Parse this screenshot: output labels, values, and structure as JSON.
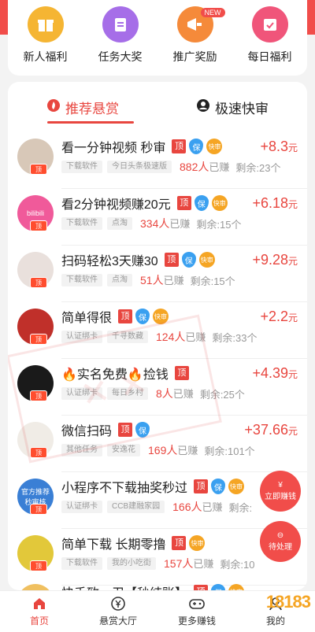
{
  "categories": [
    {
      "label": "新人福利",
      "icon": "gift-icon",
      "color": "#f5b533"
    },
    {
      "label": "任务大奖",
      "icon": "clipboard-icon",
      "color": "#a66ee8"
    },
    {
      "label": "推广奖励",
      "icon": "megaphone-icon",
      "color": "#f58a3a",
      "badge": "NEW"
    },
    {
      "label": "每日福利",
      "icon": "calendar-check-icon",
      "color": "#f0557a"
    }
  ],
  "tabs": [
    {
      "label": "推荐悬赏",
      "active": true,
      "icon": "flame-icon"
    },
    {
      "label": "极速快审",
      "active": false,
      "icon": "person-icon"
    }
  ],
  "tags": {
    "ding": "顶",
    "bao": "保",
    "kuai": "快审"
  },
  "tasks": [
    {
      "title": "看一分钟视频 秒审",
      "reward": "+8.3",
      "unit": "元",
      "chips": [
        "下载软件",
        "今日头条极速版"
      ],
      "earned": "882人",
      "earned_suffix": "已赚",
      "remain": "剩余:23个",
      "ding": true,
      "bao": true,
      "kuai": true,
      "avatar_color": "#d8c8b8"
    },
    {
      "title": "看2分钟视频赚20元",
      "reward": "+6.18",
      "unit": "元",
      "chips": [
        "下载软件",
        "点淘"
      ],
      "earned": "334人",
      "earned_suffix": "已赚",
      "remain": "剩余:15个",
      "ding": true,
      "bao": true,
      "kuai": true,
      "avatar_color": "#f05a9a",
      "avatar_text": "bilibili"
    },
    {
      "title": "扫码轻松3天赚30",
      "reward": "+9.28",
      "unit": "元",
      "chips": [
        "下载软件",
        "点淘"
      ],
      "earned": "51人",
      "earned_suffix": "已赚",
      "remain": "剩余:15个",
      "ding": true,
      "bao": true,
      "kuai": true,
      "avatar_color": "#e9e0dc"
    },
    {
      "title": "简单得很",
      "reward": "+2.2",
      "unit": "元",
      "chips": [
        "认证绑卡",
        "千寻数藏"
      ],
      "earned": "124人",
      "earned_suffix": "已赚",
      "remain": "剩余:33个",
      "ding": true,
      "bao": true,
      "kuai": true,
      "avatar_color": "#c0302a"
    },
    {
      "title": "🔥实名免费🔥捡钱",
      "reward": "+4.39",
      "unit": "元",
      "chips": [
        "认证绑卡",
        "每日乡村"
      ],
      "earned": "8人",
      "earned_suffix": "已赚",
      "remain": "剩余:25个",
      "ding": true,
      "bao": false,
      "kuai": false,
      "avatar_color": "#1a1a1a"
    },
    {
      "title": "微信扫码",
      "reward": "+37.66",
      "unit": "元",
      "chips": [
        "其他任务",
        "安逸花"
      ],
      "earned": "169人",
      "earned_suffix": "已赚",
      "remain": "剩余:101个",
      "ding": true,
      "bao": true,
      "kuai": false,
      "avatar_color": "#f0ece6"
    },
    {
      "title": "小程序不下载抽奖秒过",
      "reward": "",
      "unit": "",
      "chips": [
        "认证绑卡",
        "CCB建融家园"
      ],
      "earned": "166人",
      "earned_suffix": "已赚",
      "remain": "剩余:",
      "ding": true,
      "bao": true,
      "kuai": true,
      "avatar_color": "#3a7fd5",
      "avatar_text": "官方推荐 秒审核"
    },
    {
      "title": "简单下载 长期零撸",
      "reward": "",
      "unit": "",
      "chips": [
        "下载软件",
        "我的小吃街"
      ],
      "earned": "157人",
      "earned_suffix": "已赚",
      "remain": "剩余:10",
      "ding": true,
      "bao": false,
      "kuai": true,
      "avatar_color": "#e2c83a"
    },
    {
      "title": "快手致一卫【秒结账】",
      "reward": "",
      "unit": "",
      "chips": [],
      "earned": "",
      "earned_suffix": "",
      "remain": "",
      "ding": true,
      "bao": true,
      "kuai": true,
      "avatar_color": "#f0c060"
    }
  ],
  "float_buttons": {
    "earn": "立即赚钱",
    "pending": "待处理"
  },
  "nav": [
    {
      "label": "首页",
      "active": true,
      "icon": "home-icon"
    },
    {
      "label": "悬赏大厅",
      "active": false,
      "icon": "yen-icon"
    },
    {
      "label": "更多赚钱",
      "active": false,
      "icon": "gamepad-icon"
    },
    {
      "label": "我的",
      "active": false,
      "icon": "user-icon"
    }
  ],
  "brand": "18183"
}
